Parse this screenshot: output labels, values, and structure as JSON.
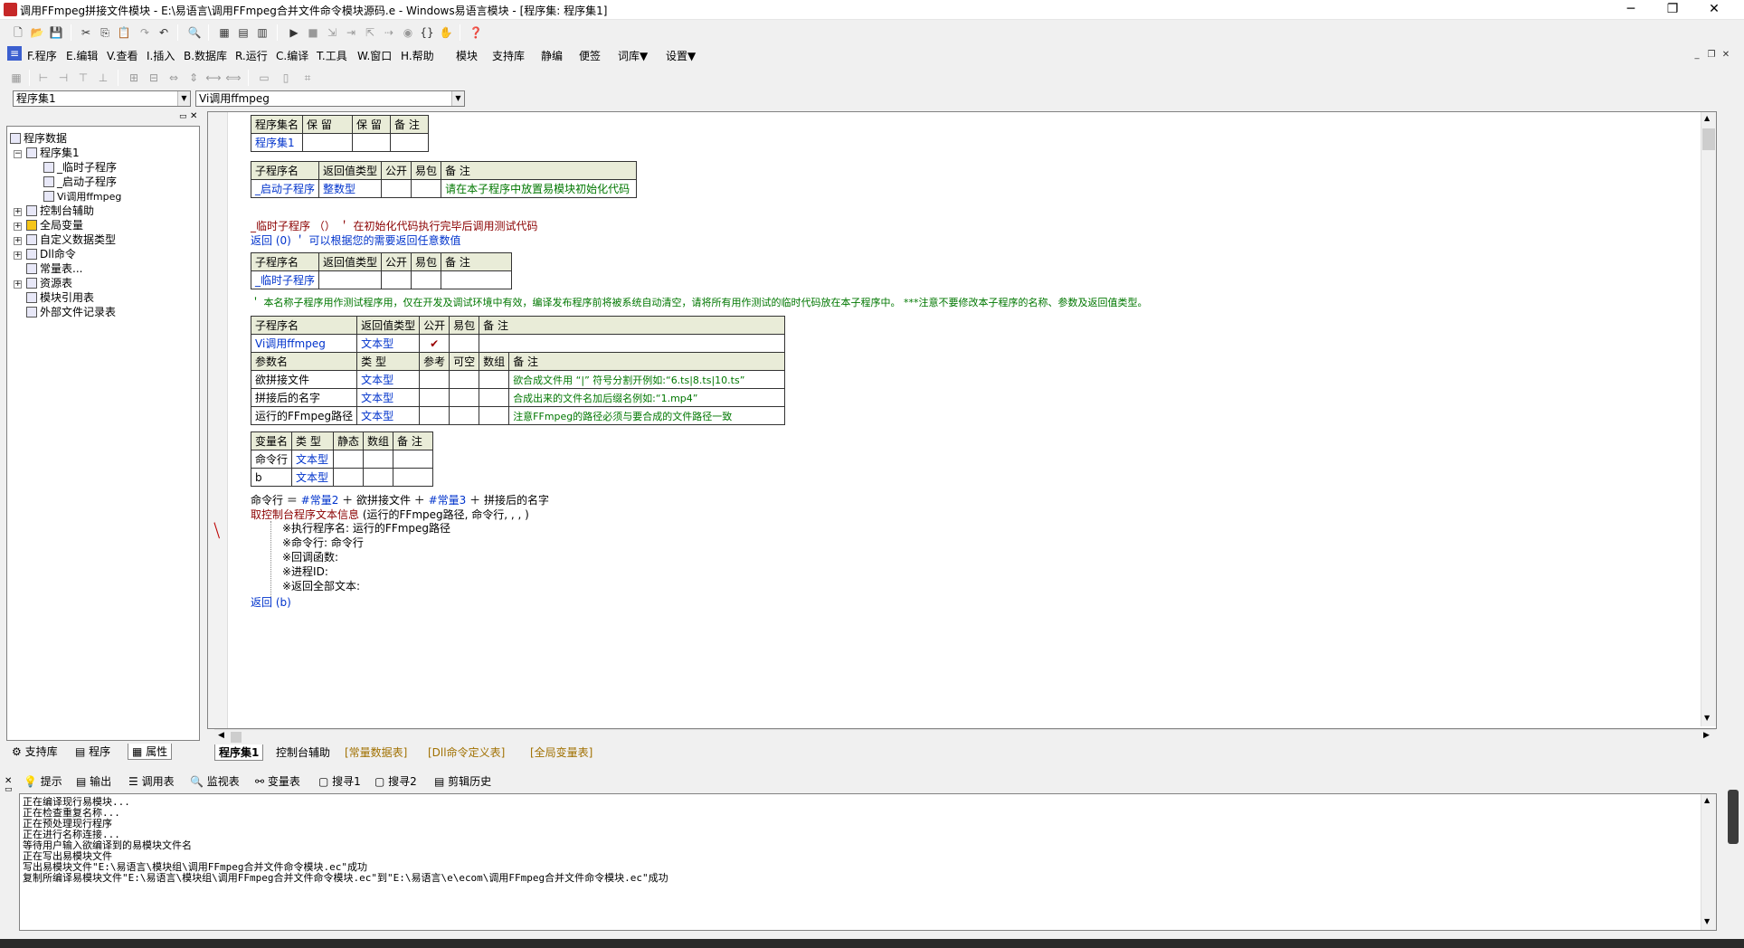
{
  "window": {
    "title": "调用FFmpeg拼接文件模块 - E:\\易语言\\调用FFmpeg合并文件命令模块源码.e - Windows易语言模块 - [程序集: 程序集1]",
    "minimize": "─",
    "maximize": "❐",
    "close": "✕"
  },
  "menu": {
    "items": [
      "F.程序",
      "E.编辑",
      "V.查看",
      "I.插入",
      "B.数据库",
      "R.运行",
      "C.编译",
      "T.工具",
      "W.窗口",
      "H.帮助",
      "模块",
      "支持库",
      "静编",
      "便签",
      "词库▼",
      "设置▼"
    ]
  },
  "combos": {
    "assembly": "程序集1",
    "subroutine": "Vi调用ffmpeg"
  },
  "tree": {
    "root": "程序数据",
    "assembly": "程序集1",
    "subs": [
      "_临时子程序",
      "_启动子程序",
      "Vi调用ffmpeg"
    ],
    "others": [
      "控制台辅助",
      "全局变量",
      "自定义数据类型",
      "Dll命令",
      "常量表...",
      "资源表",
      "模块引用表",
      "外部文件记录表"
    ]
  },
  "left_tabs": [
    "支持库",
    "程序",
    "属性"
  ],
  "editor": {
    "assembly_table": {
      "headers": [
        "程序集名",
        "保 留",
        "保 留",
        "备 注"
      ],
      "row": [
        "程序集1",
        "",
        "",
        ""
      ]
    },
    "sub_headers": [
      "子程序名",
      "返回值类型",
      "公开",
      "易包",
      "备 注"
    ],
    "start_sub": {
      "name": "_启动子程序",
      "return": "整数型",
      "comment": "请在本子程序中放置易模块初始化代码"
    },
    "temp_call": "_临时子程序 （）  ＇ 在初始化代码执行完毕后调用测试代码",
    "return0": "返回 (0)  ＇ 可以根据您的需要返回任意数值",
    "temp_sub": {
      "name": "_临时子程序"
    },
    "temp_comment": "＇ 本名称子程序用作测试程序用，仅在开发及调试环境中有效，编译发布程序前将被系统自动清空，请将所有用作测试的临时代码放在本子程序中。 ***注意不要修改本子程序的名称、参数及返回值类型。",
    "main_sub": {
      "headers": [
        "子程序名",
        "返回值类型",
        "公开",
        "易包",
        "备 注"
      ],
      "name": "Vi调用ffmpeg",
      "return": "文本型",
      "public_mark": "✔",
      "param_headers": [
        "参数名",
        "类 型",
        "参考",
        "可空",
        "数组",
        "备 注"
      ],
      "params": [
        {
          "name": "欲拼接文件",
          "type": "文本型",
          "comment": "欲合成文件用 “|” 符号分割开例如:“6.ts|8.ts|10.ts”"
        },
        {
          "name": "拼接后的名字",
          "type": "文本型",
          "comment": "合成出来的文件名加后缀名例如:“1.mp4”"
        },
        {
          "name": "运行的FFmpeg路径",
          "type": "文本型",
          "comment": "注意FFmpeg的路径必须与要合成的文件路径一致"
        }
      ]
    },
    "var_table": {
      "headers": [
        "变量名",
        "类 型",
        "静态",
        "数组",
        "备 注"
      ],
      "rows": [
        {
          "name": "命令行",
          "type": "文本型"
        },
        {
          "name": "b",
          "type": "文本型"
        }
      ]
    },
    "code": {
      "line1_a": "命令行 ＝ ",
      "line1_b": "#常量2",
      "line1_c": " ＋ 欲拼接文件 ＋ ",
      "line1_d": "#常量3",
      "line1_e": " ＋ 拼接后的名字",
      "line2_a": "取控制台程序文本信息",
      "line2_b": " (运行的FFmpeg路径, 命令行, , , )",
      "sub1": "※执行程序名:  运行的FFmpeg路径",
      "sub2": "※命令行:  命令行",
      "sub3": "※回调函数:",
      "sub4": "※进程ID:",
      "sub5": "※返回全部文本:",
      "ret": "返回 (b)"
    }
  },
  "editor_tabs": [
    "程序集1",
    "控制台辅助",
    "[常量数据表]",
    "[Dll命令定义表]",
    "[全局变量表]"
  ],
  "bottom_tabs": [
    "提示",
    "输出",
    "调用表",
    "监视表",
    "变量表",
    "搜寻1",
    "搜寻2",
    "剪辑历史"
  ],
  "output": [
    "正在编译现行易模块...",
    "正在检查重复名称...",
    "正在预处理现行程序",
    "正在进行名称连接...",
    "等待用户输入欲编译到的易模块文件名",
    "正在写出易模块文件",
    "写出易模块文件\"E:\\易语言\\模块组\\调用FFmpeg合并文件命令模块.ec\"成功",
    "复制所编译易模块文件\"E:\\易语言\\模块组\\调用FFmpeg合并文件命令模块.ec\"到\"E:\\易语言\\e\\ecom\\调用FFmpeg合并文件命令模块.ec\"成功"
  ]
}
